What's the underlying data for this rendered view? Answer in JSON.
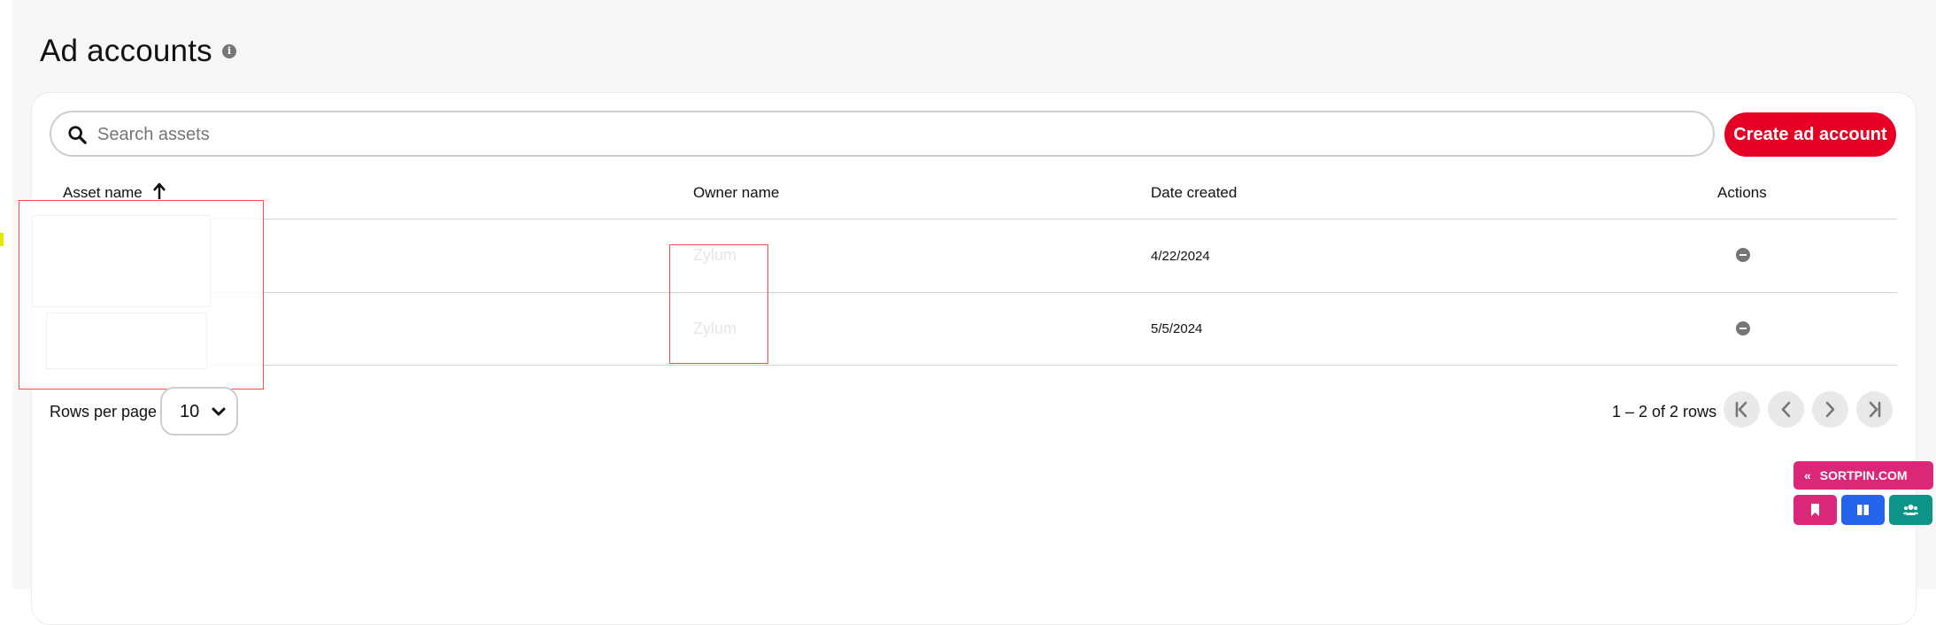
{
  "page": {
    "title": "Ad accounts",
    "info_icon": "info-icon"
  },
  "search": {
    "placeholder": "Search assets",
    "value": ""
  },
  "toolbar": {
    "create_label": "Create ad account"
  },
  "table": {
    "columns": [
      {
        "label": "Asset name",
        "sort": "ascending"
      },
      {
        "label": "Owner name"
      },
      {
        "label": "Date created"
      },
      {
        "label": "Actions"
      }
    ],
    "rows": [
      {
        "owner": "Zylum",
        "date_created": "4/22/2024",
        "action_icon": "remove-icon"
      },
      {
        "owner": "Zylum",
        "date_created": "5/5/2024",
        "action_icon": "remove-icon"
      }
    ]
  },
  "pagination": {
    "rows_per_page_label": "Rows per page",
    "rows_per_page_value": "10",
    "range_text": "1 – 2 of 2 rows",
    "buttons": [
      "first-page-icon",
      "previous-page-icon",
      "next-page-icon",
      "last-page-icon"
    ]
  },
  "extension": {
    "badge_label": "SORTPIN.COM",
    "buttons": [
      "bookmark-icon",
      "columns-icon",
      "users-icon"
    ]
  },
  "colors": {
    "accent": "#e60023",
    "sortpin_pink": "#db2777",
    "sortpin_blue": "#2563eb",
    "sortpin_teal": "#0d9488"
  }
}
